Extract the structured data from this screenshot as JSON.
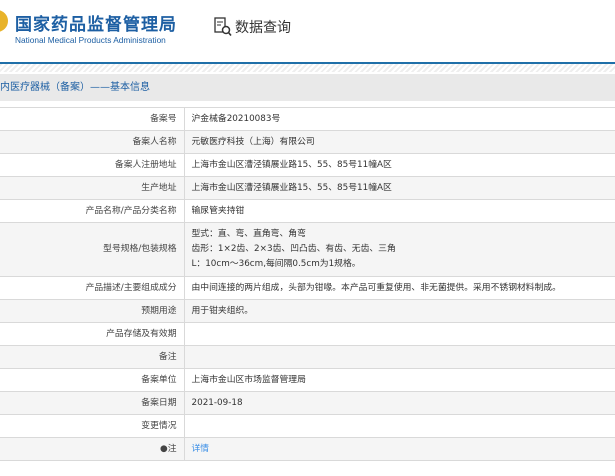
{
  "header": {
    "title_cn": "国家药品监督管理局",
    "title_en": "National Medical Products Administration",
    "query_label": "数据查询"
  },
  "breadcrumb": "内医疗器械（备案）——基本信息",
  "rows": [
    {
      "label": "备案号",
      "value": "沪金械备20210083号"
    },
    {
      "label": "备案人名称",
      "value": "元敏医疗科技（上海）有限公司"
    },
    {
      "label": "备案人注册地址",
      "value": "上海市金山区漕泾镇展业路15、55、85号11幢A区"
    },
    {
      "label": "生产地址",
      "value": "上海市金山区漕泾镇展业路15、55、85号11幢A区"
    },
    {
      "label": "产品名称/产品分类名称",
      "value": "输尿管夹持钳"
    },
    {
      "label": "型号规格/包装规格",
      "lines": [
        "型式：直、弯、直角弯、角弯",
        "齿形：1×2齿、2×3齿、凹凸齿、有齿、无齿、三角",
        "L：10cm～36cm,每间隔0.5cm为1规格。"
      ]
    },
    {
      "label": "产品描述/主要组成成分",
      "value": "由中间连接的两片组成，头部为钳喙。本产品可重复使用、非无菌提供。采用不锈钢材料制成。"
    },
    {
      "label": "预期用途",
      "value": "用于钳夹组织。"
    },
    {
      "label": "产品存储及有效期",
      "value": ""
    },
    {
      "label": "备注",
      "value": ""
    },
    {
      "label": "备案单位",
      "value": "上海市金山区市场监督管理局"
    },
    {
      "label": "备案日期",
      "value": "2021-09-18"
    },
    {
      "label": "变更情况",
      "value": ""
    },
    {
      "label": "●注",
      "link": "详情"
    }
  ]
}
